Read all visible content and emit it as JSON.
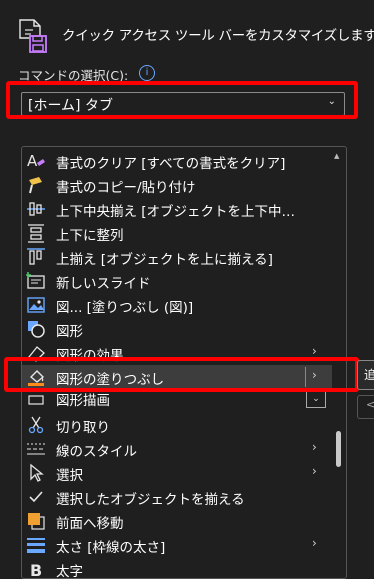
{
  "header": {
    "title": "クイック アクセス ツール バーをカスタマイズします。",
    "icon": "qat-customize-icon"
  },
  "command_select": {
    "label": "コマンドの選択(C):",
    "value": "[ホーム] タブ"
  },
  "list": {
    "items": [
      {
        "label": "書式のクリア [すべての書式をクリア]",
        "icon": "clear-format-icon"
      },
      {
        "label": "書式のコピー/貼り付け",
        "icon": "format-painter-icon"
      },
      {
        "label": "上下中央揃え [オブジェクトを上下中…",
        "icon": "align-middle-icon"
      },
      {
        "label": "上下に整列",
        "icon": "distribute-vertical-icon"
      },
      {
        "label": "上揃え [オブジェクトを上に揃える]",
        "icon": "align-top-icon"
      },
      {
        "label": "新しいスライド",
        "icon": "new-slide-icon"
      },
      {
        "label": "図... [塗りつぶし (図)]",
        "icon": "picture-fill-icon"
      },
      {
        "label": "図形",
        "icon": "shapes-icon"
      },
      {
        "label": "図形の効果",
        "icon": "shape-effects-icon",
        "submenu": true
      },
      {
        "label": "図形の塗りつぶし",
        "icon": "shape-fill-icon",
        "submenu": true,
        "selected": true
      },
      {
        "label": "図形描画",
        "icon": "drawing-icon",
        "dropdown": true
      },
      {
        "label": "切り取り",
        "icon": "scissors-icon"
      },
      {
        "label": "線のスタイル",
        "icon": "line-style-icon",
        "submenu": true
      },
      {
        "label": "選択",
        "icon": "select-cursor-icon",
        "submenu": true
      },
      {
        "label": "選択したオブジェクトを揃える",
        "icon": "checkmark-icon"
      },
      {
        "label": "前面へ移動",
        "icon": "bring-forward-icon"
      },
      {
        "label": "太さ [枠線の太さ]",
        "icon": "line-weight-icon",
        "submenu": true
      },
      {
        "label": "太字",
        "icon": "bold-icon"
      }
    ]
  },
  "right_button": {
    "label": "追"
  },
  "colors": {
    "highlight": "#ff0000",
    "background": "#1f1f1f",
    "selected_row": "#3d3d3d"
  }
}
